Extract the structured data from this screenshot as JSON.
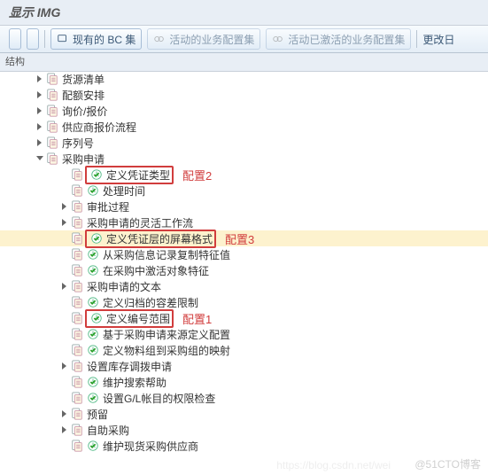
{
  "title": "显示 IMG",
  "toolbar": {
    "existing_bc": "现有的 BC 集",
    "active_bc": "活动的业务配置集",
    "activated_bc": "活动已激活的业务配置集",
    "more": "更改日"
  },
  "column_header": "结构",
  "tree": {
    "l1": [
      {
        "label": "货源清单"
      },
      {
        "label": "配额安排"
      },
      {
        "label": "询价/报价"
      },
      {
        "label": "供应商报价流程"
      },
      {
        "label": "序列号"
      }
    ],
    "po_root": "采购申请",
    "po_children": [
      {
        "label": "定义凭证类型",
        "boxed": true,
        "anno": "配置2"
      },
      {
        "label": "处理时间"
      },
      {
        "label": "审批过程",
        "parent": true
      },
      {
        "label": "采购申请的灵活工作流",
        "parent": true
      },
      {
        "label": "定义凭证层的屏幕格式",
        "boxed": true,
        "sel": true,
        "anno": "配置3"
      },
      {
        "label": "从采购信息记录复制特征值"
      },
      {
        "label": "在采购中激活对象特征"
      },
      {
        "label": "采购申请的文本",
        "parent": true
      },
      {
        "label": "定义归档的容差限制"
      },
      {
        "label": "定义编号范围",
        "boxed": true,
        "anno": "配置1"
      },
      {
        "label": "基于采购申请来源定义配置"
      },
      {
        "label": "定义物料组到采购组的映射"
      },
      {
        "label": "设置库存调拨申请",
        "parent": true
      },
      {
        "label": "维护搜索帮助"
      },
      {
        "label": "设置G/L帐目的权限检查"
      },
      {
        "label": "预留",
        "parent": true
      },
      {
        "label": "自助采购",
        "parent": true
      },
      {
        "label": "维护现货采购供应商"
      }
    ]
  },
  "watermark": "@51CTO博客",
  "watermark2": "https://blog.csdn.net/wei"
}
